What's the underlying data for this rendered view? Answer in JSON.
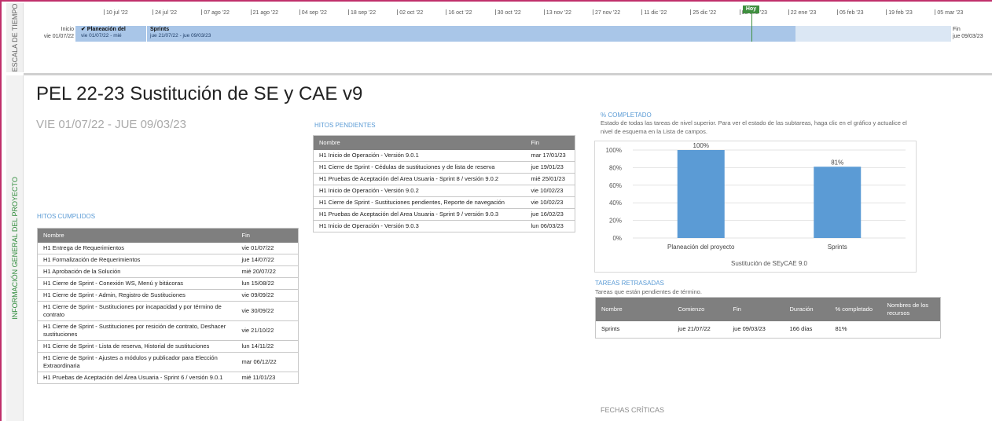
{
  "timeline": {
    "side_label": "ESCALA DE TIEMPO",
    "ticks": [
      "10 jul '22",
      "24 jul '22",
      "07 ago '22",
      "21 ago '22",
      "04 sep '22",
      "18 sep '22",
      "02 oct '22",
      "16 oct '22",
      "30 oct '22",
      "13 nov '22",
      "27 nov '22",
      "11 dic '22",
      "25 dic '22",
      "08 ene '23",
      "22 ene '23",
      "05 feb '23",
      "19 feb '23",
      "05 mar '23"
    ],
    "start_label": "Inicio",
    "start_date": "vie 01/07/22",
    "end_label": "Fin",
    "end_date": "jue 09/03/23",
    "today_label": "Hoy",
    "task1_name": "✔ Planeación del",
    "task1_dates": "vie 01/07/22 - mié",
    "task2_name": "Sprints",
    "task2_dates": "jue 21/07/22 - jue 09/03/23"
  },
  "side_main_label": "INFORMACIÓN GENERAL DEL PROYECTO",
  "project": {
    "title": "PEL 22-23 Sustitución de SE y CAE v9",
    "dates": "VIE 01/07/22  - JUE 09/03/23"
  },
  "hitos_cumplidos": {
    "title": "HITOS CUMPLIDOS",
    "headers": [
      "Nombre",
      "Fin"
    ],
    "rows": [
      [
        "H1 Entrega de Requerimientos",
        "vie 01/07/22"
      ],
      [
        "H1 Formalización de Requerimientos",
        "jue 14/07/22"
      ],
      [
        "H1 Aprobación de la Solución",
        "mié 20/07/22"
      ],
      [
        "H1 Cierre de Sprint - Conexión WS, Menú y bitácoras",
        "lun 15/08/22"
      ],
      [
        "H1 Cierre de Sprint - Admin, Registro de Sustituciones",
        "vie 09/09/22"
      ],
      [
        "H1 Cierre de Sprint - Sustituciones por incapacidad y por término de contrato",
        "vie 30/09/22"
      ],
      [
        "H1 Cierre de Sprint - Sustituciones por resición de contrato, Deshacer sustituciones",
        "vie 21/10/22"
      ],
      [
        "H1 Cierre de Sprint - Lista de reserva, Historial de sustituciones",
        "lun 14/11/22"
      ],
      [
        "H1 Cierre de Sprint - Ajustes a módulos y publicador para Elección Extraordinaria",
        "mar 06/12/22"
      ],
      [
        "H1 Pruebas de Aceptación del Área Usuaria - Sprint 6 / versión 9.0.1",
        "mié 11/01/23"
      ]
    ]
  },
  "hitos_pendientes": {
    "title": "HITOS PENDIENTES",
    "headers": [
      "Nombre",
      "Fin"
    ],
    "rows": [
      [
        "H1 Inicio de Operación - Versión 9.0.1",
        "mar 17/01/23"
      ],
      [
        "H1 Cierre de Sprint - Cédulas de sustituciones y de lista de reserva",
        "jue 19/01/23"
      ],
      [
        "H1 Pruebas de Aceptación del Area Usuaria - Sprint 8 / versión 9.0.2",
        "mié 25/01/23"
      ],
      [
        "H1 Inicio de Operación - Versión 9.0.2",
        "vie 10/02/23"
      ],
      [
        "H1 Cierre de Sprint - Sustituciones pendientes, Reporte de navegación",
        "vie 10/02/23"
      ],
      [
        "H1 Pruebas de Aceptación del Area Usuaria - Sprint 9 / versión 9.0.3",
        "jue 16/02/23"
      ],
      [
        "H1 Inicio de Operación - Versión 9.0.3",
        "lun 06/03/23"
      ]
    ]
  },
  "completado": {
    "title": "% COMPLETADO",
    "description": "Estado de todas las tareas de nivel superior. Para ver el estado de las subtareas, haga clic en el gráfico y actualice el nivel de esquema en la Lista de campos."
  },
  "chart_data": {
    "type": "bar",
    "categories": [
      "Planeación del proyecto",
      "Sprints"
    ],
    "values": [
      100,
      81
    ],
    "data_labels": [
      "100%",
      "81%"
    ],
    "xlabel": "Sustitución de SEyCAE 9.0",
    "ylabel": "",
    "ylim": [
      0,
      100
    ],
    "yticks": [
      "0%",
      "20%",
      "40%",
      "60%",
      "80%",
      "100%"
    ],
    "bar_color": "#5b9bd5",
    "grid": true
  },
  "tareas_retrasadas": {
    "title": "TAREAS RETRASADAS",
    "description": "Tareas que están pendientes de término.",
    "headers": [
      "Nombre",
      "Comienzo",
      "Fin",
      "Duración",
      "% completado",
      "Nombres de los recursos"
    ],
    "rows": [
      [
        "Sprints",
        "jue 21/07/22",
        "jue 09/03/23",
        "166 días",
        "81%",
        ""
      ]
    ]
  },
  "fechas_criticas": {
    "title": "FECHAS CRÍTICAS"
  },
  "colors": {
    "accent": "#5b9bd5",
    "header_gray": "#7f7f7f",
    "frame": "#c0306b",
    "today": "#3f8f3f"
  }
}
